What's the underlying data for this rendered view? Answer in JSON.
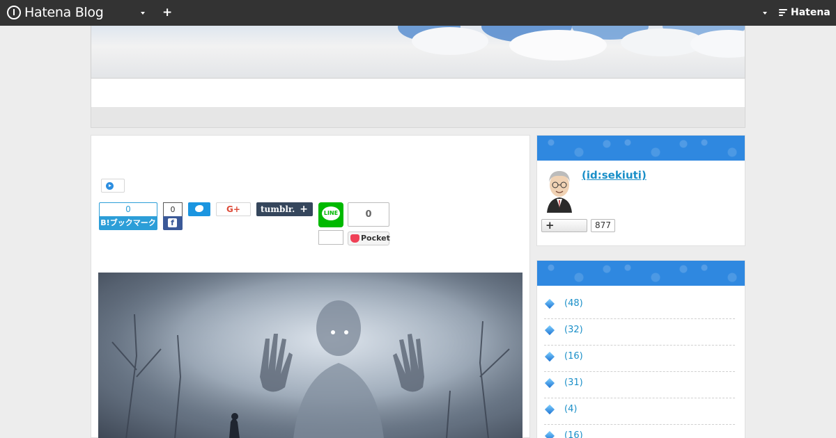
{
  "topbar": {
    "logo_text": "Hatena Blog",
    "right_logo_text": "Hatena"
  },
  "share": {
    "hatena_count": "0",
    "hatena_label": "B!ブックマーク",
    "facebook_count": "0",
    "facebook_label": "f",
    "googleplus_label": "G+",
    "tumblr_label": "tumblr.",
    "line_label": "LINE",
    "pocket_count": "0",
    "pocket_label": "Pocket"
  },
  "profile": {
    "name": " (id:sekiuti)",
    "follow_count": "877"
  },
  "categories": {
    "counts": [
      "(48)",
      "(32)",
      "(16)",
      "(31)",
      "(4)",
      "(16)"
    ]
  },
  "colors": {
    "topbar": "#333333",
    "sidebar_header": "#2f88e0",
    "link": "#1a8fc8",
    "hatena_blue": "#2c9ed8",
    "facebook": "#3b5998",
    "twitter": "#1b95e0",
    "line": "#00b900",
    "pocket": "#ef4056"
  },
  "icons": {
    "logo": "hatena-blog-logo-icon",
    "add": "plus-icon",
    "dropdown": "caret-down-icon",
    "category_bullet": "diamond-icon"
  }
}
